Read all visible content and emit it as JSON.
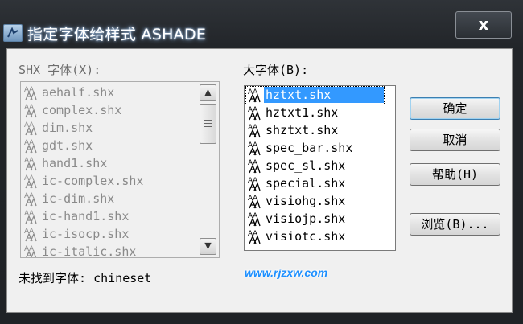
{
  "window": {
    "title": "指定字体给样式 ASHADE",
    "close_label": "x",
    "app_icon": "autocad-app-icon"
  },
  "shx_fonts": {
    "label": "SHX 字体(X):",
    "items": [
      "aehalf.shx",
      "complex.shx",
      "dim.shx",
      "gdt.shx",
      "hand1.shx",
      "ic-complex.shx",
      "ic-dim.shx",
      "ic-hand1.shx",
      "ic-isocp.shx",
      "ic-italic.shx"
    ],
    "scroll_up": "▲",
    "scroll_down": "▼"
  },
  "big_fonts": {
    "label": "大字体(B):",
    "items": [
      "hztxt.shx",
      "hztxt1.shx",
      "shztxt.shx",
      "spec_bar.shx",
      "spec_sl.shx",
      "special.shx",
      "visiohg.shx",
      "visiojp.shx",
      "visiotc.shx"
    ],
    "selected_index": 0
  },
  "buttons": {
    "ok": "确定",
    "cancel": "取消",
    "help": "帮助(H)",
    "browse": "浏览(B)..."
  },
  "status": {
    "missing_font_label": "未找到字体:",
    "missing_font_name": "chineset"
  },
  "watermark": "www.rjzxw.com",
  "colors": {
    "selection": "#3399ff",
    "watermark": "#1e90ff",
    "title_bar": "#2b2f34"
  }
}
